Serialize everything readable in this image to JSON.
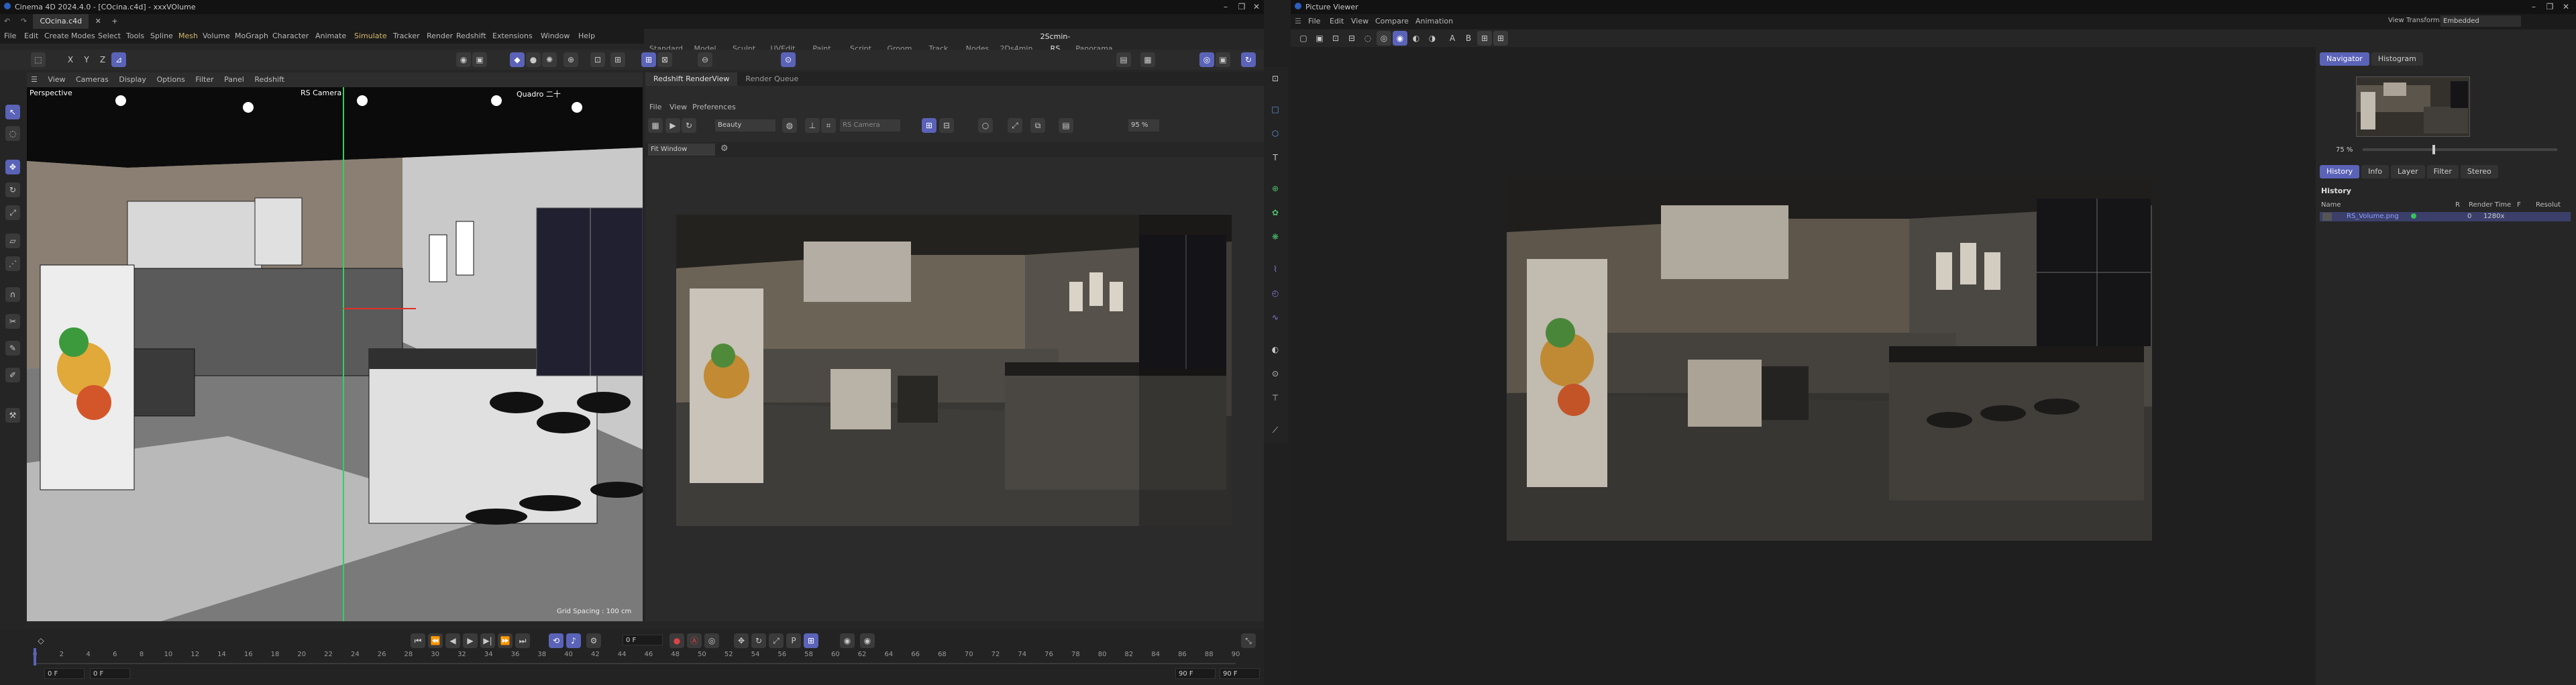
{
  "c4d": {
    "title": "Cinema 4D 2024.4.0 - [COcina.c4d] - xxxVOlume",
    "file_tab": "COcina.c4d",
    "menu": [
      "File",
      "Edit",
      "Create",
      "Modes",
      "Select",
      "Tools",
      "Spline",
      "Mesh",
      "Volume",
      "MoGraph",
      "Character",
      "Animate",
      "Simulate",
      "Tracker",
      "Render",
      "Redshift",
      "Extensions",
      "Window",
      "Help"
    ],
    "layouts": [
      "Standard",
      "Model",
      "Sculpt",
      "UVEdit",
      "Paint",
      "Script",
      "Groom",
      "Track",
      "Nodes",
      "2Ds4min",
      "2Scmin-RS",
      "Panorama"
    ],
    "active_layout": "2Scmin-RS",
    "viewport_menu": [
      "View",
      "Cameras",
      "Display",
      "Options",
      "Filter",
      "Panel",
      "Redshift"
    ],
    "viewport": {
      "label_perspective": "Perspective",
      "label_camera": "RS Camera",
      "label_quad": "Quadro 二十",
      "grid_spacing": "Grid Spacing : 100 cm"
    },
    "renderview": {
      "tabs": [
        "Redshift RenderView",
        "Render Queue"
      ],
      "menu": [
        "File",
        "View",
        "Preferences"
      ],
      "aov": "Beauty",
      "camera": "RS Camera",
      "zoom": "95 %",
      "fit": "Fit Window"
    },
    "timeline": {
      "current_frame": "0 F",
      "start": "0 F",
      "min": "0 F",
      "end": "90 F",
      "max": "90 F",
      "ticks": [
        "0",
        "2",
        "4",
        "6",
        "8",
        "10",
        "12",
        "14",
        "16",
        "18",
        "20",
        "22",
        "24",
        "26",
        "28",
        "30",
        "32",
        "34",
        "36",
        "38",
        "40",
        "42",
        "44",
        "46",
        "48",
        "50",
        "52",
        "54",
        "56",
        "58",
        "60",
        "62",
        "64",
        "66",
        "68",
        "70",
        "72",
        "74",
        "76",
        "78",
        "80",
        "82",
        "84",
        "86",
        "88",
        "90"
      ]
    }
  },
  "pv": {
    "title": "Picture Viewer",
    "menu": [
      "File",
      "Edit",
      "View",
      "Compare",
      "Animation"
    ],
    "view_transform_label": "View Transform:",
    "view_transform_value": "Embedded",
    "nav_tabs": [
      "Navigator",
      "Histogram"
    ],
    "zoom": "75 %",
    "tabs": [
      "History",
      "Info",
      "Layer",
      "Filter",
      "Stereo"
    ],
    "history_title": "History",
    "columns": [
      "Name",
      "R",
      "Render Time",
      "F",
      "Resolut"
    ],
    "row": {
      "name": "RS_Volume.png",
      "frame": "0",
      "res": "1280x"
    }
  },
  "colors": {
    "accent": "#5a63b8",
    "panel": "#262626",
    "title": "#121212"
  }
}
